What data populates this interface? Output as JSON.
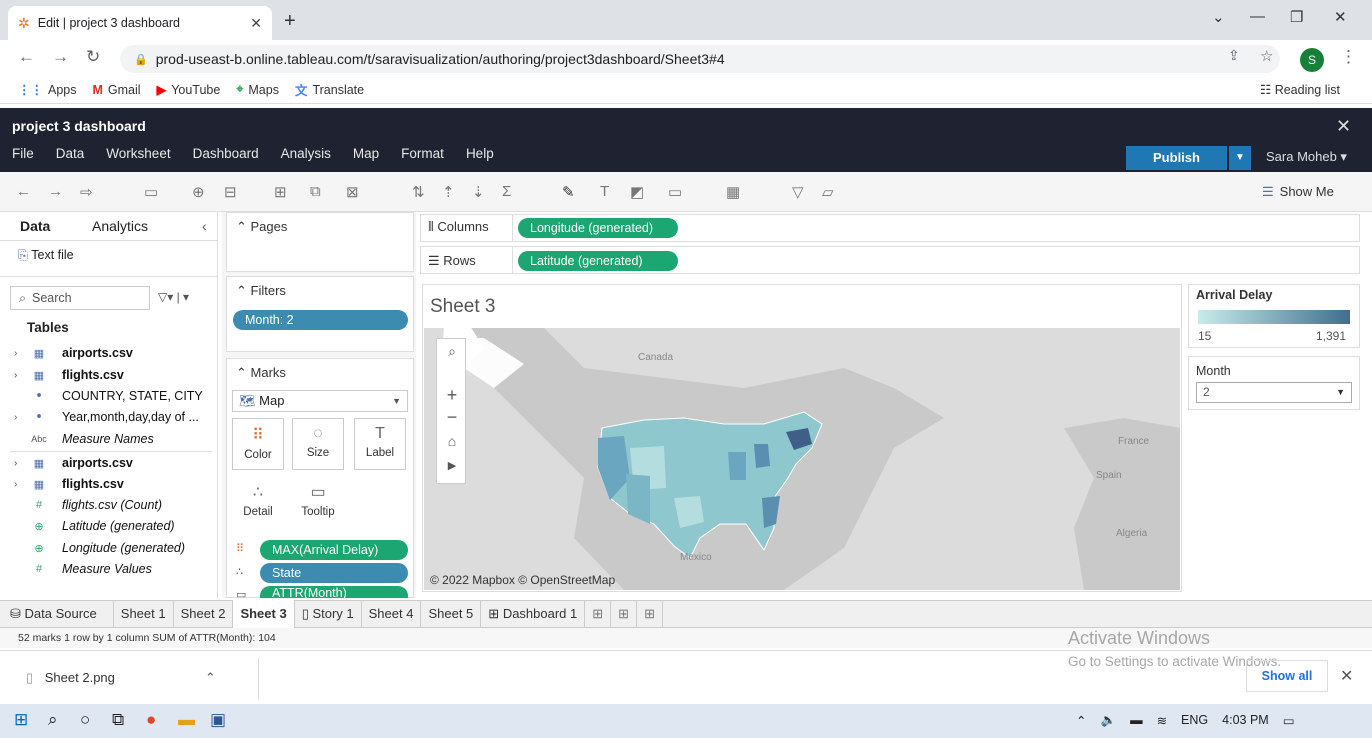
{
  "browser": {
    "tab_title": "Edit | project 3 dashboard",
    "url": "prod-useast-b.online.tableau.com/t/saravisualization/authoring/project3dashboard/Sheet3#4",
    "avatar_letter": "S",
    "bookmarks": [
      "Apps",
      "Gmail",
      "YouTube",
      "Maps",
      "Translate"
    ],
    "reading_list": "Reading list"
  },
  "tableau": {
    "workbook_title": "project 3 dashboard",
    "menu": [
      "File",
      "Data",
      "Worksheet",
      "Dashboard",
      "Analysis",
      "Map",
      "Format",
      "Help"
    ],
    "publish_label": "Publish",
    "user": "Sara Moheb ▾",
    "show_me": "Show Me"
  },
  "data_pane": {
    "tabs": [
      "Data",
      "Analytics"
    ],
    "source": "Text file",
    "search_placeholder": "Search",
    "tables_header": "Tables",
    "fields": [
      {
        "label": "airports.csv",
        "icon": "table-icon"
      },
      {
        "label": "flights.csv",
        "icon": "table-icon"
      },
      {
        "label": "COUNTRY, STATE, CITY",
        "icon": "hierarchy-icon"
      },
      {
        "label": "Year,month,day,day of ...",
        "icon": "hierarchy-icon"
      },
      {
        "label": "Measure Names",
        "icon": "abc-icon"
      },
      {
        "label": "airports.csv",
        "icon": "table-icon"
      },
      {
        "label": "flights.csv",
        "icon": "table-icon"
      },
      {
        "label": "flights.csv (Count)",
        "icon": "hash-icon"
      },
      {
        "label": "Latitude (generated)",
        "icon": "globe-icon"
      },
      {
        "label": "Longitude (generated)",
        "icon": "globe-icon"
      },
      {
        "label": "Measure Values",
        "icon": "hash-icon"
      }
    ]
  },
  "shelves": {
    "pages": "Pages",
    "filters": "Filters",
    "filter_pill": "Month: 2",
    "marks": "Marks",
    "mark_type": "Map",
    "mark_buttons": [
      "Color",
      "Size",
      "Label",
      "Detail",
      "Tooltip"
    ],
    "mark_pills": [
      "MAX(Arrival Delay)",
      "State",
      "ATTR(Month)"
    ],
    "columns_label": "Columns",
    "columns_pill": "Longitude (generated)",
    "rows_label": "Rows",
    "rows_pill": "Latitude (generated)"
  },
  "sheet": {
    "title": "Sheet 3",
    "attribution": "© 2022 Mapbox © OpenStreetMap",
    "map_labels": [
      "Canada",
      "Mexico",
      "France",
      "Spain",
      "Algeria"
    ]
  },
  "legends": {
    "color_title": "Arrival Delay",
    "min": "15",
    "max": "1,391",
    "filter_title": "Month",
    "filter_value": "2",
    "colors": {
      "low": "#c8ecea",
      "high": "#3f6f8d"
    }
  },
  "tabs": [
    "Data Source",
    "Sheet 1",
    "Sheet 2",
    "Sheet 3",
    "Story 1",
    "Sheet 4",
    "Sheet 5",
    "Dashboard 1"
  ],
  "active_tab": "Sheet 3",
  "status": "52 marks   1 row by 1 column   SUM of ATTR(Month): 104",
  "download": {
    "file": "Sheet 2.png",
    "show_all": "Show all"
  },
  "watermark": {
    "line1": "Activate Windows",
    "line2": "Go to Settings to activate Windows."
  },
  "taskbar": {
    "lang": "ENG",
    "time": "4:03 PM"
  }
}
